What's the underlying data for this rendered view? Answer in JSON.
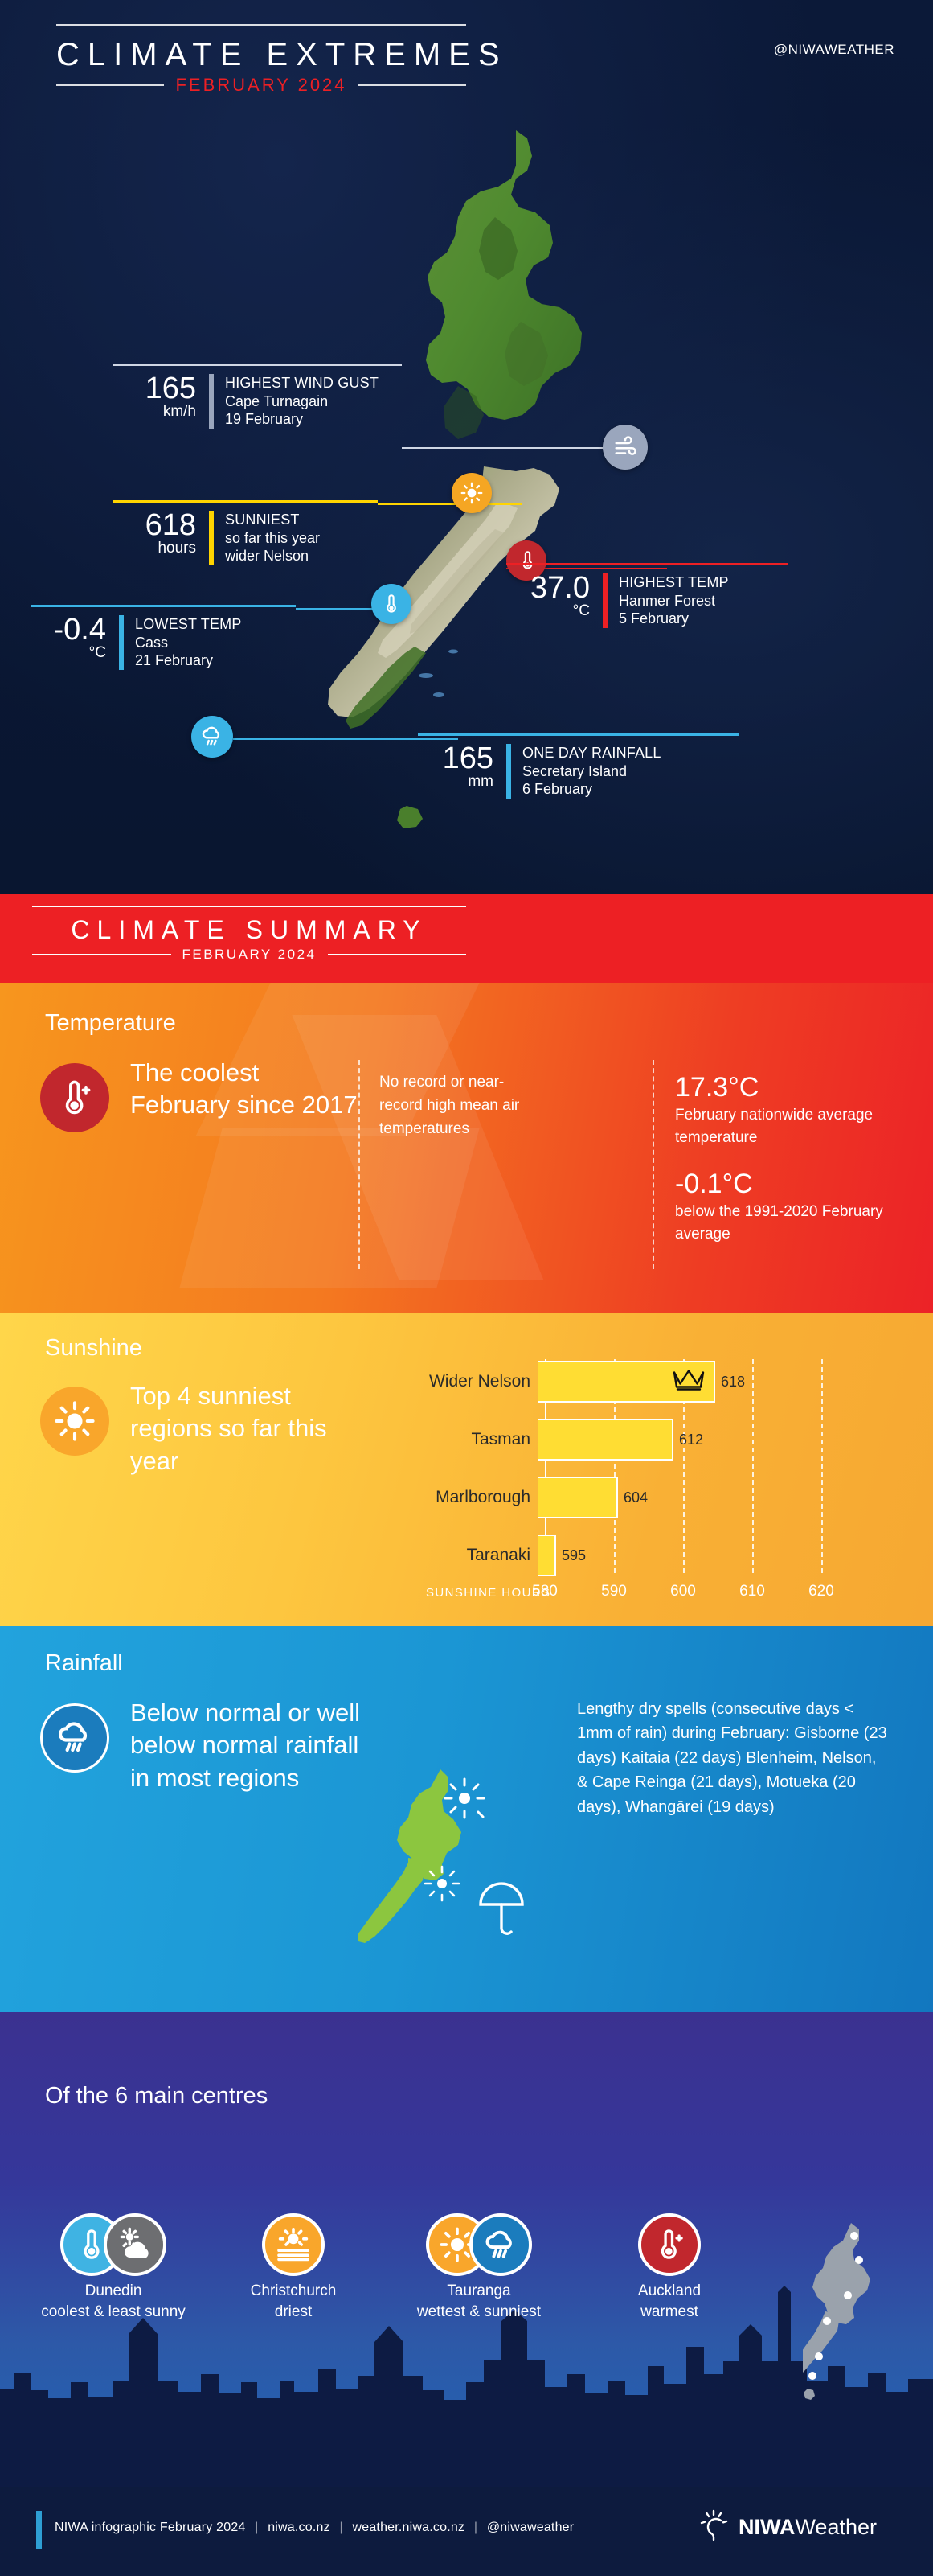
{
  "extremes": {
    "title": "CLIMATE EXTREMES",
    "subtitle": "FEBRUARY 2024",
    "handle": "@NIWAWEATHER",
    "callouts": [
      {
        "value": "165",
        "unit": "km/h",
        "label": "HIGHEST WIND GUST",
        "place": "Cape Turnagain",
        "date": "19 February",
        "color": "#cfd6e4"
      },
      {
        "value": "618",
        "unit": "hours",
        "label": "SUNNIEST",
        "place": "so far this year",
        "date": "wider Nelson",
        "color": "#ffd400"
      },
      {
        "value": "-0.4",
        "unit": "°C",
        "label": "LOWEST TEMP",
        "place": "Cass",
        "date": "21 February",
        "color": "#3ab3e5"
      },
      {
        "value": "37.0",
        "unit": "°C",
        "label": "HIGHEST TEMP",
        "place": "Hanmer Forest",
        "date": "5 February",
        "color": "#ed2024"
      },
      {
        "value": "165",
        "unit": "mm",
        "label": "ONE DAY RAINFALL",
        "place": "Secretary Island",
        "date": "6 February",
        "color": "#3ab3e5"
      }
    ]
  },
  "summary_header": {
    "title": "CLIMATE SUMMARY",
    "subtitle": "FEBRUARY 2024"
  },
  "temperature": {
    "section_title": "Temperature",
    "headline": "The coolest February since 2017",
    "note": "No record or near-record high mean air temperatures",
    "stat1_value": "17.3°C",
    "stat1_text": "February nationwide average temperature",
    "stat2_value": "-0.1°C",
    "stat2_text": "below the 1991-2020 February average"
  },
  "sunshine": {
    "section_title": "Sunshine",
    "headline": "Top 4 sunniest regions so far this year",
    "axis_caption": "SUNSHINE HOURS"
  },
  "rainfall": {
    "section_title": "Rainfall",
    "headline": "Below normal or well below normal rainfall in most regions",
    "note": "Lengthy dry spells (consecutive days < 1mm of rain) during February: Gisborne (23 days) Kaitaia (22 days) Blenheim, Nelson, & Cape Reinga (21 days), Motueka (20 days), Whangārei (19 days)"
  },
  "centres": {
    "title": "Of the 6 main centres",
    "items": [
      {
        "name": "Dunedin",
        "desc": "coolest & least sunny",
        "icons": [
          "thermometer-cold-icon",
          "cloudy-icon"
        ]
      },
      {
        "name": "Christchurch",
        "desc": "driest",
        "icons": [
          "dry-sun-icon"
        ]
      },
      {
        "name": "Tauranga",
        "desc": "wettest & sunniest",
        "icons": [
          "sun-icon",
          "rain-cloud-icon"
        ]
      },
      {
        "name": "Auckland",
        "desc": "warmest",
        "icons": [
          "thermometer-hot-icon"
        ]
      }
    ]
  },
  "footer": {
    "line": "NIWA infographic February 2024",
    "link1": "niwa.co.nz",
    "link2": "weather.niwa.co.nz",
    "handle": "@niwaweather",
    "logo_bold": "NIWA",
    "logo_light": "Weather"
  },
  "chart_data": {
    "type": "bar",
    "orientation": "horizontal",
    "title": "Top 4 sunniest regions so far this year",
    "categories": [
      "Wider Nelson",
      "Tasman",
      "Marlborough",
      "Taranaki"
    ],
    "values": [
      618,
      612,
      604,
      595
    ],
    "data_labels": [
      "618",
      "612",
      "604",
      "595"
    ],
    "xlabel": "SUNSHINE HOURS",
    "ylabel": "",
    "xlim": [
      575,
      623
    ],
    "xticks": [
      580,
      590,
      600,
      610,
      620
    ],
    "xtick_labels": [
      "580",
      "590",
      "600",
      "610",
      "620"
    ],
    "grid": true,
    "legend": false,
    "bar_color": "#ffdd33",
    "annotations": [
      {
        "category": "Wider Nelson",
        "icon": "crown-icon"
      }
    ]
  }
}
